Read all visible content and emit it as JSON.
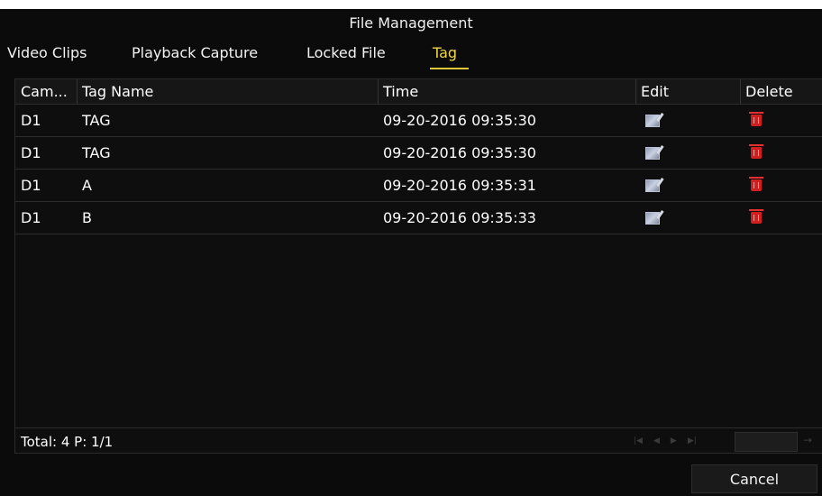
{
  "window": {
    "title": "File Management"
  },
  "tabs": [
    {
      "label": "Video Clips",
      "active": false
    },
    {
      "label": "Playback Capture",
      "active": false
    },
    {
      "label": "Locked File",
      "active": false
    },
    {
      "label": "Tag",
      "active": true
    }
  ],
  "table": {
    "columns": [
      "Cam...",
      "Tag Name",
      "Time",
      "Edit",
      "Delete"
    ],
    "rows": [
      {
        "camera": "D1",
        "tag_name": "TAG",
        "time": "09-20-2016 09:35:30",
        "edit_icon": "edit-icon",
        "delete_icon": "trash-icon"
      },
      {
        "camera": "D1",
        "tag_name": "TAG",
        "time": "09-20-2016 09:35:30",
        "edit_icon": "edit-icon",
        "delete_icon": "trash-icon"
      },
      {
        "camera": "D1",
        "tag_name": "A",
        "time": "09-20-2016 09:35:31",
        "edit_icon": "edit-icon",
        "delete_icon": "trash-icon"
      },
      {
        "camera": "D1",
        "tag_name": "B",
        "time": "09-20-2016 09:35:33",
        "edit_icon": "edit-icon",
        "delete_icon": "trash-icon"
      }
    ]
  },
  "footer": {
    "summary": "Total: 4 P: 1/1",
    "pager_icons": [
      "first-page-icon",
      "prev-page-icon",
      "next-page-icon",
      "last-page-icon"
    ],
    "page_input_value": "",
    "go_icon": "go-arrow-icon"
  },
  "buttons": {
    "cancel": "Cancel"
  },
  "colors": {
    "background": "#0b0b0b",
    "active_tab": "#f0d64a",
    "delete_icon": "#d11f1f",
    "edit_icon": "#aeb7cc"
  }
}
